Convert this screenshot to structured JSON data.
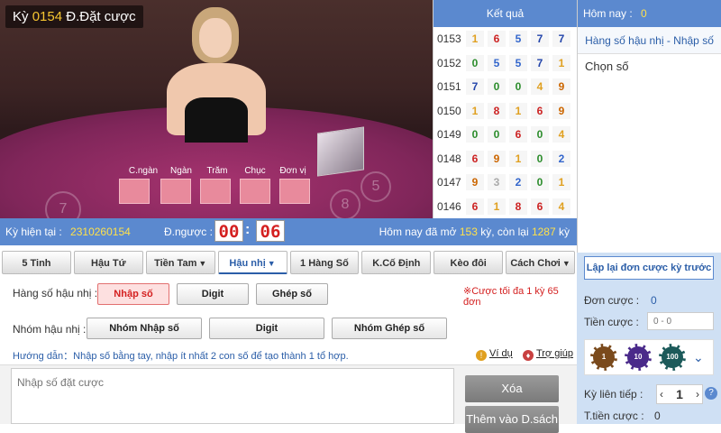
{
  "ticket": {
    "prefix": "Kỳ",
    "number": "0154",
    "status": "Đ.Đặt cược"
  },
  "table_labels": [
    "C.ngàn",
    "Ngàn",
    "Trăm",
    "Chục",
    "Đơn vị"
  ],
  "table_marks": [
    "7",
    "5",
    "8"
  ],
  "results": {
    "title": "Kết quả",
    "rows": [
      {
        "id": "0153",
        "digits": [
          "1",
          "6",
          "5",
          "7",
          "7"
        ]
      },
      {
        "id": "0152",
        "digits": [
          "0",
          "5",
          "5",
          "7",
          "1"
        ]
      },
      {
        "id": "0151",
        "digits": [
          "7",
          "0",
          "0",
          "4",
          "9"
        ]
      },
      {
        "id": "0150",
        "digits": [
          "1",
          "8",
          "1",
          "6",
          "9"
        ]
      },
      {
        "id": "0149",
        "digits": [
          "0",
          "0",
          "6",
          "0",
          "4"
        ]
      },
      {
        "id": "0148",
        "digits": [
          "6",
          "9",
          "1",
          "0",
          "2"
        ]
      },
      {
        "id": "0147",
        "digits": [
          "9",
          "3",
          "2",
          "0",
          "1"
        ]
      },
      {
        "id": "0146",
        "digits": [
          "6",
          "1",
          "8",
          "6",
          "4"
        ]
      }
    ]
  },
  "today": {
    "label": "Hôm nay :",
    "value": "0"
  },
  "mode_title": "Hàng số hậu nhị - Nhập số",
  "picked_label": "Chọn số",
  "status": {
    "current_label": "Kỳ hiện tại :",
    "current_value": "2310260154",
    "countdown_label": "Đ.ngược :",
    "minutes": "00",
    "seconds": "06",
    "summary_prefix": "Hôm nay đã mở",
    "opened": "153",
    "summary_mid": "kỳ, còn lại",
    "remaining": "1287",
    "summary_suffix": "kỳ"
  },
  "tabs": [
    "5 Tinh",
    "Hậu Tứ",
    "Tiền Tam",
    "Hậu nhị",
    "1 Hàng Số",
    "K.Cố Định",
    "Kèo đôi",
    "Cách Chơi"
  ],
  "form": {
    "row1_label": "Hàng số hậu nhị :",
    "row1_buttons": [
      "Nhập số",
      "Digit",
      "Ghép số"
    ],
    "limit_note": "※Cược tối đa 1 kỳ 65 đơn",
    "row2_label": "Nhóm hậu nhị :",
    "row2_buttons": [
      "Nhóm Nhập số",
      "Digit",
      "Nhóm Ghép số"
    ],
    "hint": "Hướng dẫn：Nhập số bằng tay, nhập ít nhất 2 con số để tạo thành 1 tổ hợp.",
    "example": "Ví dụ",
    "help": "Trợ giúp",
    "input_placeholder": "Nhập số đặt cược",
    "clear": "Xóa",
    "add": "Thêm vào D.sách"
  },
  "side": {
    "repeat": "Lập lại đơn cược kỳ trước",
    "order_label": "Đơn cược :",
    "order_value": "0",
    "money_label": "Tiền cược :",
    "money_placeholder": "0 - 0",
    "chips": [
      "1",
      "10",
      "100"
    ],
    "consecutive_label": "Kỳ liên tiếp :",
    "consecutive_value": "1",
    "total_label": "T.tiền cược :",
    "total_value": "0"
  }
}
